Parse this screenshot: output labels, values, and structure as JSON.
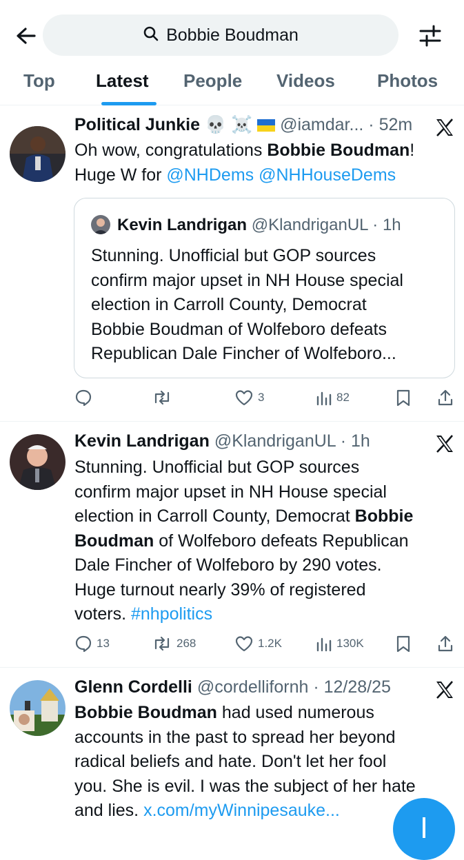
{
  "search": {
    "query": "Bobbie Boudman"
  },
  "tabs": [
    {
      "label": "Top",
      "active": false
    },
    {
      "label": "Latest",
      "active": true
    },
    {
      "label": "People",
      "active": false
    },
    {
      "label": "Videos",
      "active": false
    },
    {
      "label": "Photos",
      "active": false
    }
  ],
  "tweets": [
    {
      "name": "Political Junkie",
      "emojis": "💀 ☠️",
      "handle": "@iamdar...",
      "time": "52m",
      "text": {
        "t1": "Oh wow, congratulations ",
        "bold1": "Bobbie Boudman",
        "t2": "!",
        "t3": "Huge W for ",
        "mention1": "@NHDems",
        "mention2": "@NHHouseDems"
      },
      "quote": {
        "name": "Kevin Landrigan",
        "handle": "@KlandriganUL",
        "time": "1h",
        "lines": [
          "Stunning. Unofficial but GOP sources",
          "confirm major upset in NH House special",
          "election in Carroll County, Democrat",
          "Bobbie Boudman of Wolfeboro defeats",
          "Republican Dale Fincher of Wolfeboro..."
        ]
      },
      "stats": {
        "replies": "",
        "reposts": "",
        "likes": "3",
        "views": "82"
      }
    },
    {
      "name": "Kevin Landrigan",
      "handle": "@KlandriganUL",
      "time": "1h",
      "text": {
        "l1": "Stunning. Unofficial but GOP sources",
        "l2": "confirm major upset in NH House special",
        "l3a": "election in Carroll County, Democrat ",
        "l3b": "Bobbie",
        "l4a": "Boudman",
        "l4b": " of Wolfeboro defeats Republican",
        "l5": "Dale Fincher of Wolfeboro by 290 votes.",
        "l6": "Huge turnout nearly 39% of registered",
        "l7a": "voters. ",
        "l7b": "#nhpolitics"
      },
      "stats": {
        "replies": "13",
        "reposts": "268",
        "likes": "1.2K",
        "views": "130K"
      }
    },
    {
      "name": "Glenn Cordelli",
      "handle": "@cordellifornh",
      "time": "12/28/25",
      "text": {
        "l1a": "Bobbie Boudman",
        "l1b": " had used numerous",
        "l2": "accounts in the past to spread her beyond",
        "l3": "radical beliefs and hate. Don't let her fool",
        "l4": "you. She is evil. I was the subject of her hate",
        "l5a": "and lies. ",
        "l5b": "x.com/myWinnipesauke..."
      }
    }
  ],
  "colors": {
    "accent": "#1d9bf0",
    "text": "#0f1419",
    "muted": "#536471"
  },
  "icons": [
    "back-arrow-icon",
    "search-icon",
    "filter-icon",
    "x-logo-icon",
    "reply-icon",
    "repost-icon",
    "like-icon",
    "views-icon",
    "bookmark-icon",
    "share-icon",
    "plus-icon"
  ]
}
